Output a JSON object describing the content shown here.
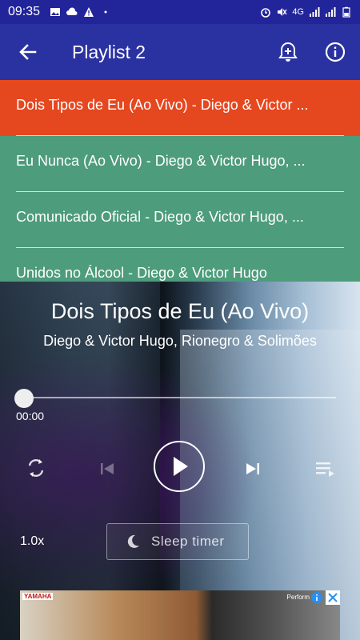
{
  "status_bar": {
    "time": "09:35",
    "network": "4G",
    "colors": {
      "background": "#22249a"
    }
  },
  "app_bar": {
    "title": "Playlist 2",
    "back_icon": "arrow-left-icon",
    "alarm_icon": "alarm-add-icon",
    "info_icon": "info-icon",
    "colors": {
      "background": "#2a31a0"
    }
  },
  "playlist": {
    "tracks": [
      {
        "label": "Dois Tipos de Eu (Ao Vivo) - Diego & Victor ...",
        "active": true
      },
      {
        "label": "Eu Nunca (Ao Vivo) - Diego & Victor Hugo, ...",
        "active": false
      },
      {
        "label": "Comunicado Oficial - Diego & Victor Hugo, ...",
        "active": false
      },
      {
        "label": "Unidos no Álcool - Diego & Victor Hugo",
        "active": false
      }
    ],
    "colors": {
      "active": "#e5471f",
      "background": "#4d9c7c"
    }
  },
  "player": {
    "title": "Dois Tipos de Eu (Ao Vivo)",
    "artist": "Diego & Victor Hugo, Rionegro & Solimões",
    "elapsed": "00:00",
    "progress": 0,
    "speed": "1.0x",
    "sleep_timer_label": "Sleep timer",
    "icons": [
      "repeat-icon",
      "skip-previous-icon",
      "play-icon",
      "skip-next-icon",
      "queue-icon",
      "moon-icon"
    ]
  },
  "ad": {
    "brand": "YAMAHA",
    "text": "Perform"
  }
}
